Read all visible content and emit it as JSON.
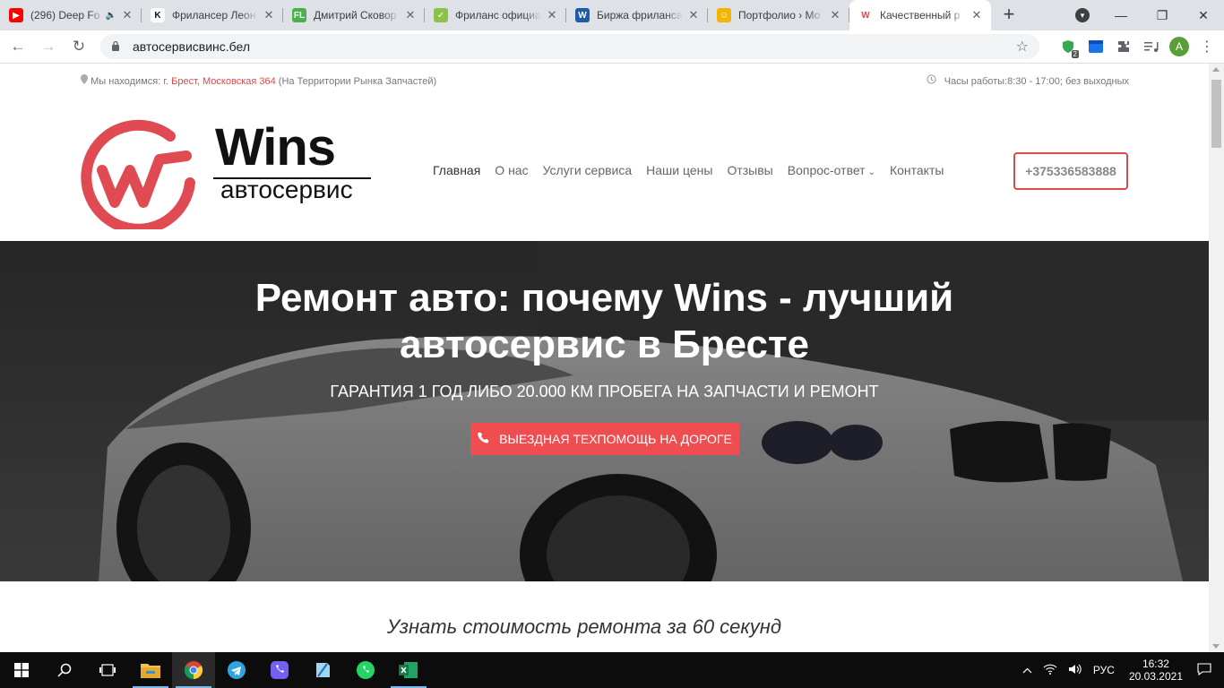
{
  "browser": {
    "tabs": [
      {
        "title": "(296) Deep Fo",
        "fav_color": "#ff0000",
        "fav_glyph": "▶",
        "audio": true
      },
      {
        "title": "Фрилансер Леон",
        "fav_color": "#ffffff",
        "fav_glyph": "K"
      },
      {
        "title": "Дмитрий Сковор",
        "fav_color": "#4caf50",
        "fav_glyph": "FL"
      },
      {
        "title": "Фриланс официа",
        "fav_color": "#8bc34a",
        "fav_glyph": "✓"
      },
      {
        "title": "Биржа фриланса",
        "fav_color": "#1e5ba8",
        "fav_glyph": "W"
      },
      {
        "title": "Портфолио › Мо",
        "fav_color": "#f4b400",
        "fav_glyph": "☺"
      },
      {
        "title": "Качественный р",
        "fav_color": "#ffffff",
        "fav_glyph": "W",
        "active": true
      }
    ],
    "url": "автосервисвинс.бел",
    "profile_initial": "A",
    "ext_badge": "2"
  },
  "site": {
    "location_label": "Мы находимся:",
    "location_link": "г. Брест, Московская 364",
    "location_note": "(На Территории Рынка Запчастей)",
    "hours": "Часы работы:8:30 - 17:00; без выходных",
    "logo_brand": "Wins",
    "logo_sub": "автосервис",
    "brand_color": "#e04a52",
    "nav": [
      {
        "label": "Главная",
        "active": true
      },
      {
        "label": "О нас"
      },
      {
        "label": "Услуги сервиса"
      },
      {
        "label": "Наши цены"
      },
      {
        "label": "Отзывы"
      },
      {
        "label": "Вопрос-ответ",
        "dropdown": true
      },
      {
        "label": "Контакты"
      }
    ],
    "phone": "+375336583888",
    "hero_title_line1": "Ремонт авто: почему Wins - лучший",
    "hero_title_line2": "автосервис в Бресте",
    "hero_subtitle": "ГАРАНТИЯ 1 ГОД ЛИБО 20.000 КМ ПРОБЕГА НА ЗАПЧАСТИ И РЕМОНТ",
    "hero_button": "ВЫЕЗДНАЯ ТЕХПОМОЩЬ НА ДОРОГЕ",
    "card_title": "Узнать стоимость ремонта за 60 секунд"
  },
  "taskbar": {
    "lang": "РУС",
    "time": "16:32",
    "date": "20.03.2021"
  }
}
